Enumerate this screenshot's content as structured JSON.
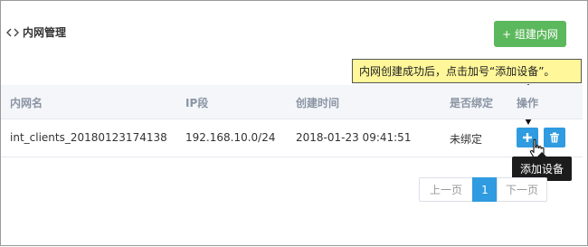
{
  "panel": {
    "title": "内网管理",
    "create_button": "+ 组建内网"
  },
  "callout": {
    "text": "内网创建成功后，点击加号“添加设备”。"
  },
  "table": {
    "headers": [
      "内网名",
      "IP段",
      "创建时间",
      "是否绑定",
      "操作"
    ],
    "rows": [
      [
        "int_clients_20180123174138",
        "192.168.10.0/24",
        "2018-01-23 09:41:51",
        "未绑定"
      ]
    ]
  },
  "tooltip": {
    "text": "添加设备"
  },
  "pagination": {
    "prev": "上一页",
    "current": "1",
    "next": "下一页"
  },
  "colors": {
    "accent": "#2f9be0",
    "create_button": "#5cb85c",
    "callout_bg": "#fff799"
  }
}
